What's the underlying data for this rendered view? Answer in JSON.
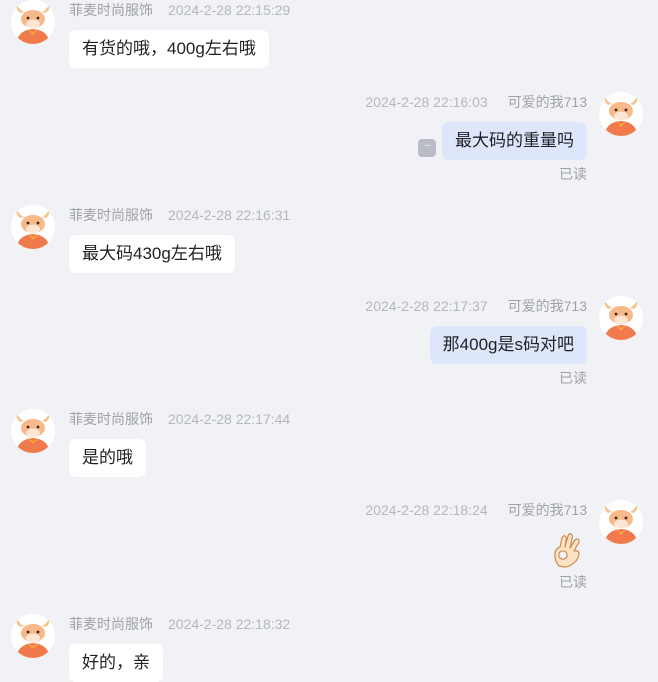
{
  "messages": [
    {
      "side": "left",
      "sender": "菲麦时尚服饰",
      "time": "2024-2-28 22:15:29",
      "text": "有货的哦，400g左右哦"
    },
    {
      "side": "right",
      "sender": "可爱的我713",
      "time": "2024-2-28 22:16:03",
      "text": "最大码的重量吗",
      "status": "已读",
      "has_more_button": true
    },
    {
      "side": "left",
      "sender": "菲麦时尚服饰",
      "time": "2024-2-28 22:16:31",
      "text": "最大码430g左右哦"
    },
    {
      "side": "right",
      "sender": "可爱的我713",
      "time": "2024-2-28 22:17:37",
      "text": "那400g是s码对吧",
      "status": "已读"
    },
    {
      "side": "left",
      "sender": "菲麦时尚服饰",
      "time": "2024-2-28 22:17:44",
      "text": "是的哦"
    },
    {
      "side": "right",
      "sender": "可爱的我713",
      "time": "2024-2-28 22:18:24",
      "emoji": "ok-hand-icon",
      "status": "已读"
    },
    {
      "side": "left",
      "sender": "菲麦时尚服饰",
      "time": "2024-2-28 22:18:32",
      "text": "好的，亲"
    }
  ],
  "more_button_label": "···",
  "colors": {
    "background": "#f1f2f6",
    "bubble_incoming": "#ffffff",
    "bubble_outgoing": "#dde6fb",
    "avatar_accent": "#f07a4c"
  }
}
